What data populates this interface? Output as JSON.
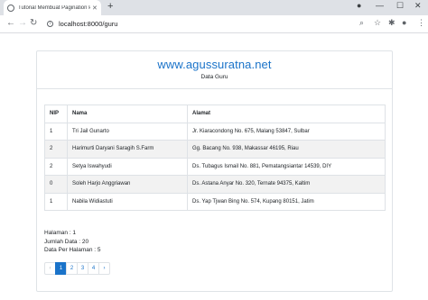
{
  "browser": {
    "tab_title": "Tutorial Membuat Pagination Pa",
    "url": "localhost:8000/guru",
    "icons": [
      "favicon-icon",
      "close-icon",
      "new-tab-icon",
      "back-icon",
      "forward-icon",
      "reload-icon",
      "info-icon",
      "search-icon",
      "star-icon",
      "extensions-icon",
      "profile-icon",
      "menu-icon"
    ]
  },
  "header": {
    "site_title": "www.agussuratna.net",
    "subtitle": "Data Guru",
    "title_color": "#1a73c9"
  },
  "table": {
    "columns": [
      "NIP",
      "Nama",
      "Alamat"
    ],
    "rows": [
      {
        "nip": "1",
        "nama": "Tri Jail Gunarto",
        "alamat": "Jr. Kiaracondong No. 675, Malang 53847, Sulbar"
      },
      {
        "nip": "2",
        "nama": "Harimurti Daryani Saragih S.Farm",
        "alamat": "Gg. Bacang No. 938, Makassar 46195, Riau"
      },
      {
        "nip": "2",
        "nama": "Setya Iswahyudi",
        "alamat": "Ds. Tubagus Ismail No. 881, Pematangsiantar 14539, DIY"
      },
      {
        "nip": "0",
        "nama": "Soleh Harjo Anggriawan",
        "alamat": "Ds. Astana Anyar No. 320, Ternate 94375, Kaltim"
      },
      {
        "nip": "1",
        "nama": "Nabila Widiastuti",
        "alamat": "Ds. Yap Tjwan Bing No. 574, Kupang 80151, Jatim"
      }
    ]
  },
  "stats": {
    "halaman": "Halaman : 1",
    "jumlah_data": "Jumlah Data : 20",
    "data_per_halaman": "Data Per Halaman : 5"
  },
  "pagination": {
    "prev": "‹",
    "pages": [
      "1",
      "2",
      "3",
      "4"
    ],
    "active_page": "1",
    "next": "›"
  }
}
